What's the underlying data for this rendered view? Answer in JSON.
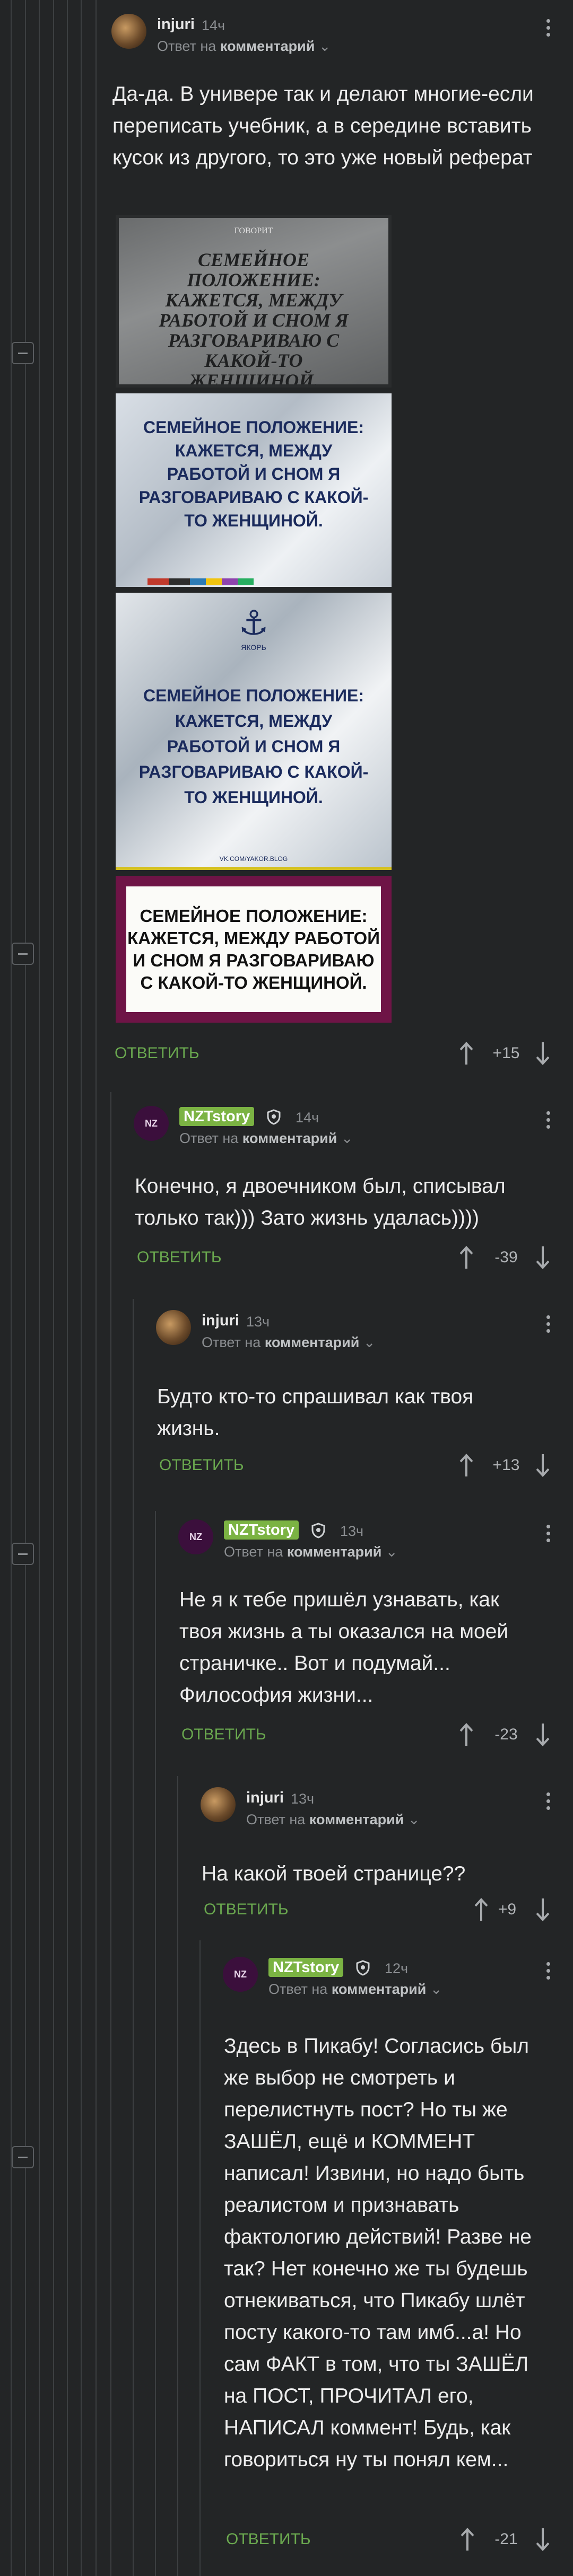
{
  "comments": [
    {
      "author": "injuri",
      "time": "14ч",
      "reply_prefix": "Ответ на",
      "reply_target": "комментарий",
      "text": "Да-да. В универе так и делают многие-если переписать учебник, а в середине вставить кусок из другого, то это уже новый реферат",
      "reply_label": "ОТВЕТИТЬ",
      "score": "+15",
      "images": [
        {
          "top_label": "ГОВОРИТ",
          "text": "СЕМЕЙНОЕ ПОЛОЖЕНИЕ: КАЖЕТСЯ, МЕЖДУ РАБОТОЙ И СНОМ Я РАЗГОВАРИВАЮ С КАКОЙ-ТО ЖЕНЩИНОЙ."
        },
        {
          "text": "СЕМЕЙНОЕ ПОЛОЖЕНИЕ: КАЖЕТСЯ, МЕЖДУ РАБОТОЙ И СНОМ Я РАЗГОВАРИВАЮ С КАКОЙ-ТО ЖЕНЩИНОЙ."
        },
        {
          "logo": "ЯКОРЬ",
          "text": "СЕМЕЙНОЕ ПОЛОЖЕНИЕ: КАЖЕТСЯ, МЕЖДУ РАБОТОЙ И СНОМ Я РАЗГОВАРИВАЮ С КАКОЙ-ТО ЖЕНЩИНОЙ.",
          "footer": "VK.COM/YAKOR.BLOG"
        },
        {
          "text": "СЕМЕЙНОЕ ПОЛОЖЕНИЕ: КАЖЕТСЯ, МЕЖДУ РАБОТОЙ И СНОМ Я РАЗГОВАРИВАЮ С КАКОЙ-ТО ЖЕНЩИНОЙ."
        }
      ]
    },
    {
      "author": "NZTstory",
      "avatar_text": "NZ",
      "time": "14ч",
      "reply_prefix": "Ответ на",
      "reply_target": "комментарий",
      "text": "Конечно, я двоечником был, списывал только так))) Зато жизнь удалась))))",
      "reply_label": "ОТВЕТИТЬ",
      "score": "-39"
    },
    {
      "author": "injuri",
      "time": "13ч",
      "reply_prefix": "Ответ на",
      "reply_target": "комментарий",
      "text": "Будто кто-то спрашивал как твоя жизнь.",
      "reply_label": "ОТВЕТИТЬ",
      "score": "+13"
    },
    {
      "author": "NZTstory",
      "avatar_text": "NZ",
      "time": "13ч",
      "reply_prefix": "Ответ на",
      "reply_target": "комментарий",
      "text": "Не я к тебе пришёл узнавать, как твоя жизнь а ты оказался на моей страничке.. Вот и подумай... Философия жизни...",
      "reply_label": "ОТВЕТИТЬ",
      "score": "-23"
    },
    {
      "author": "injuri",
      "time": "13ч",
      "reply_prefix": "Ответ на",
      "reply_target": "комментарий",
      "text": "На какой твоей странице??",
      "reply_label": "ОТВЕТИТЬ",
      "score": "+9"
    },
    {
      "author": "NZTstory",
      "avatar_text": "NZ",
      "time": "12ч",
      "reply_prefix": "Ответ на",
      "reply_target": "комментарий",
      "text": "Здесь в Пикабу! Согласись был же выбор не смотреть и перелистнуть пост? Но ты же ЗАШЁЛ, ещё и КОММЕНТ написал! Извини, но надо быть реалистом и признавать фактологию действий! Разве не так? Нет конечно же ты будешь отнекиваться, что Пикабу шлёт посту какого-то там имб...а! Но сам ФАКТ в том, что ты ЗАШЁЛ на ПОСТ, ПРОЧИТАЛ его, НАПИСАЛ коммент! Будь, как говориться ну ты понял кем...",
      "reply_label": "ОТВЕТИТЬ",
      "score": "-21"
    }
  ],
  "colors": {
    "background": "#232526",
    "accent_green": "#6aa84f",
    "badge_green": "#7bb343",
    "muted": "#8b8e91"
  }
}
